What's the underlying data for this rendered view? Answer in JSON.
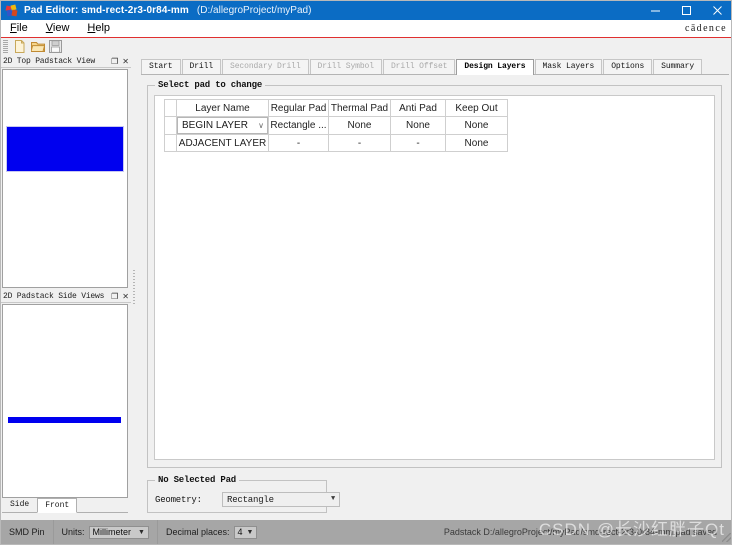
{
  "window": {
    "title": "Pad Editor: smd-rect-2r3-0r84-mm",
    "path": "(D:/allegroProject/myPad)",
    "minimize": "─",
    "maximize": "□",
    "close": "✕"
  },
  "menu": {
    "items": [
      {
        "mnemonic": "F",
        "rest": "ile"
      },
      {
        "mnemonic": "V",
        "rest": "iew"
      },
      {
        "mnemonic": "H",
        "rest": "elp"
      }
    ],
    "brand": "cādence"
  },
  "toolbar": {
    "buttons": [
      {
        "name": "new-icon",
        "label": "New"
      },
      {
        "name": "open-icon",
        "label": "Open"
      },
      {
        "name": "save-icon",
        "label": "Save"
      }
    ]
  },
  "left_dock": {
    "top_panel": {
      "title": "2D Top Padstack View",
      "float_btn": "❐",
      "close_btn": "✕",
      "pad_color": "#0000ef"
    },
    "side_panel": {
      "title": "2D Padstack Side Views",
      "float_btn": "❐",
      "close_btn": "✕",
      "pad_color": "#0000ef",
      "tabs": [
        {
          "label": "Side",
          "active": false
        },
        {
          "label": "Front",
          "active": true
        }
      ]
    }
  },
  "main": {
    "tabs": [
      {
        "label": "Start",
        "active": false,
        "disabled": false
      },
      {
        "label": "Drill",
        "active": false,
        "disabled": false
      },
      {
        "label": "Secondary Drill",
        "active": false,
        "disabled": true
      },
      {
        "label": "Drill Symbol",
        "active": false,
        "disabled": true
      },
      {
        "label": "Drill Offset",
        "active": false,
        "disabled": true
      },
      {
        "label": "Design Layers",
        "active": true,
        "disabled": false
      },
      {
        "label": "Mask Layers",
        "active": false,
        "disabled": false
      },
      {
        "label": "Options",
        "active": false,
        "disabled": false
      },
      {
        "label": "Summary",
        "active": false,
        "disabled": false
      }
    ],
    "select_group": {
      "title": "Select pad to change",
      "table": {
        "columns": [
          "",
          "Layer Name",
          "Regular Pad",
          "Thermal Pad",
          "Anti Pad",
          "Keep Out"
        ],
        "rows": [
          {
            "type": "combo",
            "layer_name": "BEGIN LAYER",
            "chevron": "∨",
            "regular_pad": "Rectangle ...",
            "thermal_pad": "None",
            "anti_pad": "None",
            "keep_out": "None"
          },
          {
            "type": "static",
            "layer_name": "ADJACENT LAYER",
            "regular_pad": "-",
            "thermal_pad": "-",
            "anti_pad": "-",
            "keep_out": "None"
          }
        ]
      }
    },
    "no_selected_group": {
      "title": "No Selected Pad",
      "geometry_label": "Geometry:",
      "geometry_value": "Rectangle",
      "geometry_arrow": "▼"
    }
  },
  "status_bar": {
    "pin_type": "SMD Pin",
    "units_label": "Units:",
    "units_value": "Millimeter",
    "decimal_label": "Decimal places:",
    "decimal_value": "4",
    "arrow": "▼",
    "status_text": "Padstack D:/allegroProject/myPad/smd-rect-2r3-0r84-mm.pad saved"
  },
  "watermark": "CSDN @长沙红胖子Qt"
}
